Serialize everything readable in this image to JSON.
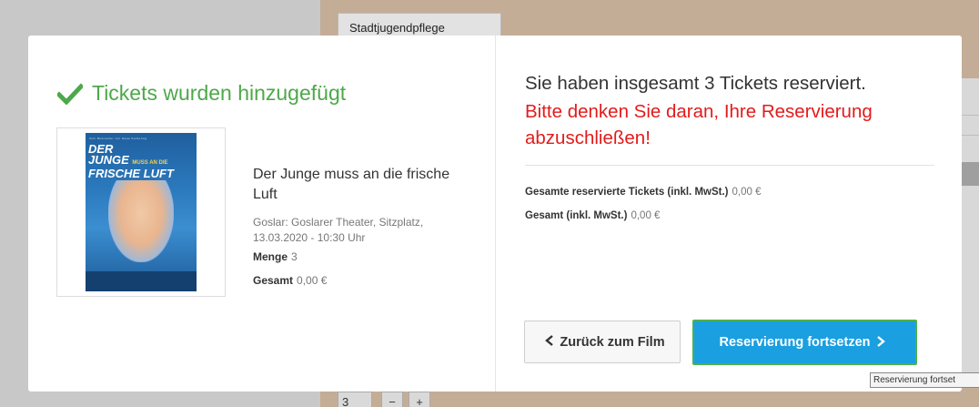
{
  "background": {
    "tab_label": "Stadtjugendpflege",
    "quantity_value": "3",
    "minus_label": "−",
    "plus_label": "+",
    "tooltip": "Reservierung fortset"
  },
  "modal": {
    "left": {
      "heading": "Tickets wurden hinzugefügt",
      "poster": {
        "top_text": "Vom Bestseller von Hape Kerkeling",
        "title_line1": "DER",
        "title_line2": "JUNGE",
        "title_line3": "MUSS AN DIE",
        "title_line4": "FRISCHE LUFT"
      },
      "film_title": "Der Junge muss an die frische Luft",
      "film_info": "Goslar: Goslarer Theater, Sitzplatz, 13.03.2020 - 10:30 Uhr",
      "quantity_label": "Menge",
      "quantity_value": "3",
      "total_label": "Gesamt",
      "total_value": "0,00 €"
    },
    "right": {
      "summary": "Sie haben insgesamt 3 Tickets reserviert.",
      "warning": "Bitte denken Sie daran, Ihre Reservierung abzuschließen!",
      "reserved_total_label": "Gesamte reservierte Tickets (inkl. MwSt.)",
      "reserved_total_value": "0,00 €",
      "total_label": "Gesamt (inkl. MwSt.)",
      "total_value": "0,00 €",
      "back_button": "Zurück zum Film",
      "continue_button": "Reservierung fortsetzen"
    }
  },
  "colors": {
    "success": "#4ea84a",
    "warning": "#e31b1b",
    "primary_button": "#1a9fe1",
    "primary_button_border": "#4caf50"
  },
  "icons": {
    "heading_icon": "check-icon",
    "back_icon": "chevron-left-icon",
    "continue_icon": "chevron-right-icon"
  }
}
